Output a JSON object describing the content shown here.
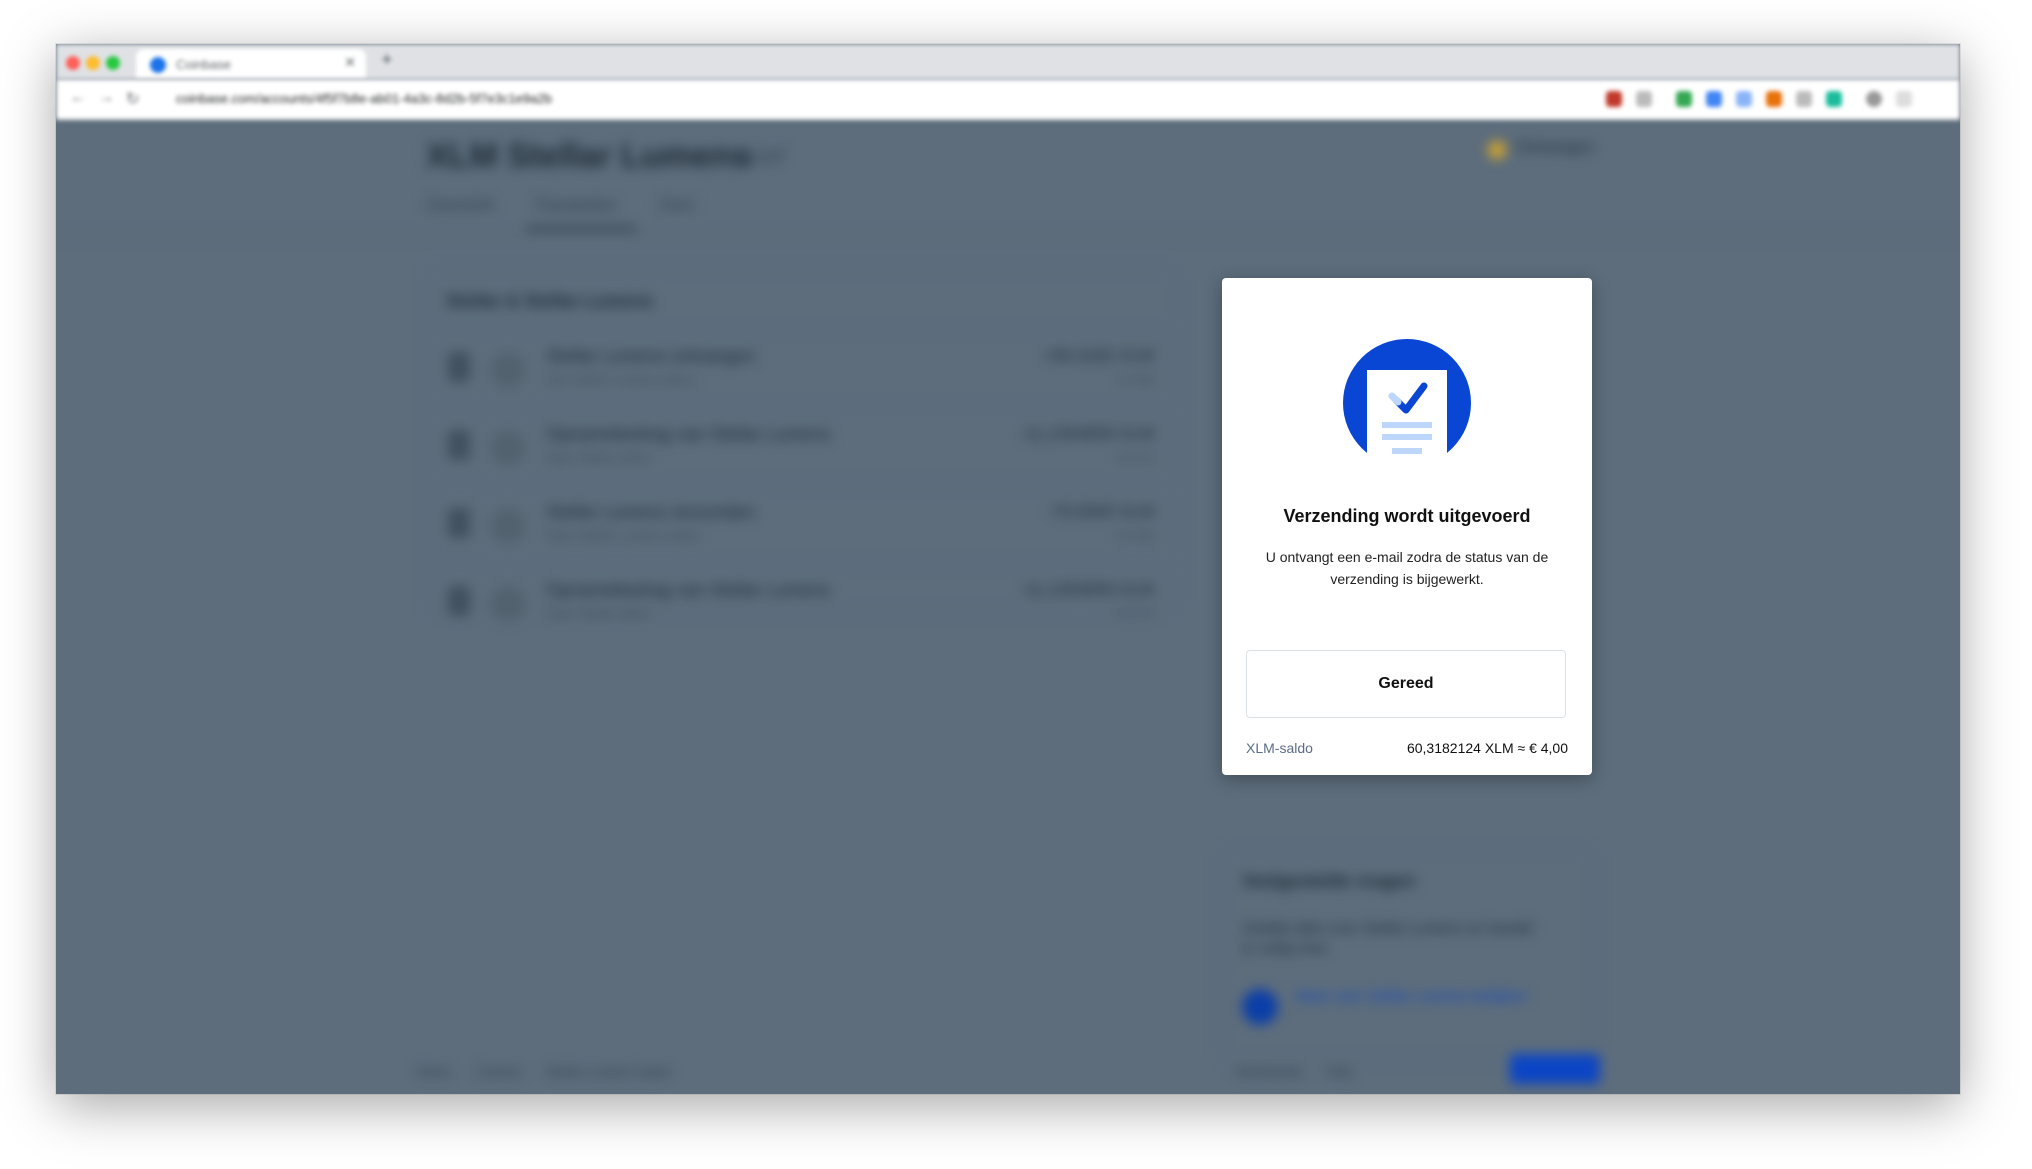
{
  "browser": {
    "tab_title": "Coinbase",
    "url": "coinbase.com/accounts/4f5f7b8e-ab01-4a3c-8d2b-5f7e3c1e9a2b"
  },
  "page": {
    "title": "Stellar Lumens",
    "title_prefix": "XLM",
    "price": "€ 0,07",
    "top_right": "Ontvangen",
    "tabs": [
      "Overzicht",
      "Transacties",
      "Over"
    ],
    "list_heading": "Stellar & Stellar Lumens",
    "rows": [
      {
        "title": "Stellar Lumens ontvangen",
        "sub": "Van Stellar Lumens adres",
        "amount": "+60,3182 XLM",
        "fiat": "€ 4,00"
      },
      {
        "title": "Opnamebedrag van Stellar Lumens",
        "sub": "Naar Stellar-adres",
        "amount": "-11,1354659 XLM",
        "fiat": "-€ 0,74"
      },
      {
        "title": "Stellar Lumens verzonden",
        "sub": "Naar Stellar Lumens adres",
        "amount": "-70,0000 XLM",
        "fiat": "-€ 4,65"
      },
      {
        "title": "Opnamebedrag van Stellar Lumens",
        "sub": "Naar Stellar-adres",
        "amount": "-11,1354659 XLM",
        "fiat": "-€ 0,74"
      }
    ],
    "side_heading": "Veelgestelde vragen",
    "side_text": "Ontdek alles over Stellar Lumens en handel er veilig mee.",
    "side_link": "Meer over Stellar Lumens bekijken",
    "footer_links": [
      "Home",
      "Careers",
      "Stellar Lumens kopen"
    ],
    "footer_right": [
      "Nederlands",
      "Help"
    ]
  },
  "modal": {
    "title": "Verzending wordt uitgevoerd",
    "text": "U ontvangt een e-mail zodra de status van de verzending is bijgewerkt.",
    "button": "Gereed",
    "balance_label": "XLM-saldo",
    "balance_value": "60,3182124 XLM  ≈ € 4,00"
  },
  "colors": {
    "accent": "#0a46d4",
    "overlay": "#5d6d7c"
  }
}
